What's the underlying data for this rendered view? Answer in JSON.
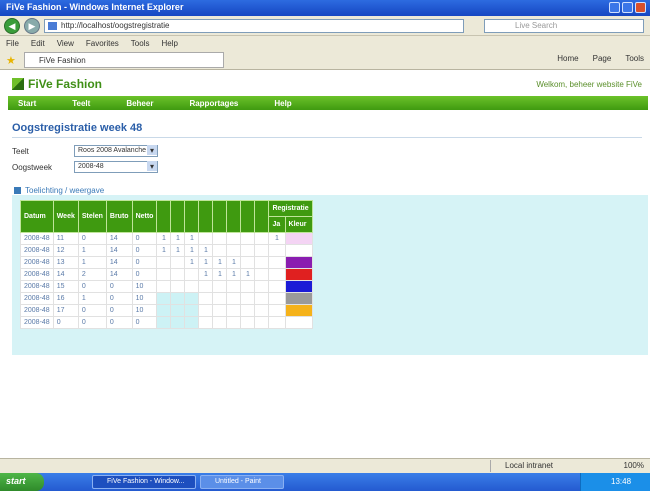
{
  "window": {
    "title": "FiVe Fashion - Windows Internet Explorer"
  },
  "browser": {
    "address": "http://localhost/oogstregistratie",
    "search_placeholder": "Live Search",
    "menu": [
      "File",
      "Edit",
      "View",
      "Favorites",
      "Tools",
      "Help"
    ],
    "tab_title": "FiVe Fashion",
    "tools": [
      "Home",
      "Page",
      "Tools"
    ]
  },
  "site": {
    "logo": "FiVe Fashion",
    "top_right": "Welkom, beheer website FiVe",
    "nav": [
      "Start",
      "Teelt",
      "Beheer",
      "Rapportages",
      "Help"
    ]
  },
  "page": {
    "title": "Oogstregistratie week 48",
    "form": {
      "teelt_label": "Teelt",
      "teelt_value": "Roos 2008 Avalanche",
      "oogstweek_label": "Oogstweek",
      "oogstweek_value": "2008-48"
    },
    "legend_link": "Toelichting / weergave"
  },
  "table": {
    "headers": [
      "Datum",
      "Week",
      "Stelen",
      "Bruto",
      "Netto",
      "",
      "",
      "",
      "",
      "",
      "",
      "",
      "",
      "",
      "Registratie"
    ],
    "sub_headers": [
      "Ja",
      "Kleur"
    ],
    "rows": [
      {
        "cells": [
          "2008-48",
          "11",
          "0",
          "14",
          "0"
        ],
        "slots": [
          "1",
          "1",
          "1",
          "",
          "",
          "",
          "",
          ""
        ],
        "check": "1",
        "color": "#f4d4f4"
      },
      {
        "cells": [
          "2008-48",
          "12",
          "1",
          "14",
          "0"
        ],
        "slots": [
          "1",
          "1",
          "1",
          "1",
          "",
          "",
          "",
          ""
        ],
        "check": "",
        "color": ""
      },
      {
        "cells": [
          "2008-48",
          "13",
          "1",
          "14",
          "0"
        ],
        "slots": [
          "",
          "",
          "1",
          "1",
          "1",
          "1",
          "",
          ""
        ],
        "check": "",
        "color": "#8a1db0"
      },
      {
        "cells": [
          "2008-48",
          "14",
          "2",
          "14",
          "0"
        ],
        "slots": [
          "",
          "",
          "",
          "1",
          "1",
          "1",
          "1",
          ""
        ],
        "check": "",
        "color": "#e02020"
      },
      {
        "cells": [
          "2008-48",
          "15",
          "0",
          "0",
          "10"
        ],
        "slots": [
          "",
          "",
          "",
          "",
          "",
          "",
          "",
          ""
        ],
        "check": "",
        "color": "#1b1bd6"
      },
      {
        "cells": [
          "2008-48",
          "16",
          "1",
          "0",
          "10"
        ],
        "slots": [
          "",
          "",
          "",
          "",
          "",
          "",
          "",
          ""
        ],
        "check": "",
        "color": "#9a9a9a"
      },
      {
        "cells": [
          "2008-48",
          "17",
          "0",
          "0",
          "10"
        ],
        "slots": [
          "",
          "",
          "",
          "",
          "",
          "",
          "",
          ""
        ],
        "check": "",
        "color": "#f5b21a"
      },
      {
        "cells": [
          "2008-48",
          "0",
          "0",
          "0",
          "0"
        ],
        "slots": [
          "",
          "",
          "",
          "",
          "",
          "",
          "",
          ""
        ],
        "check": "",
        "color": ""
      }
    ]
  },
  "status": {
    "zone": "Local intranet",
    "zoom": "100%"
  },
  "taskbar": {
    "start": "start",
    "tasks": [
      "FiVe Fashion - Window...",
      "Untitled - Paint"
    ],
    "clock": "13:48"
  }
}
